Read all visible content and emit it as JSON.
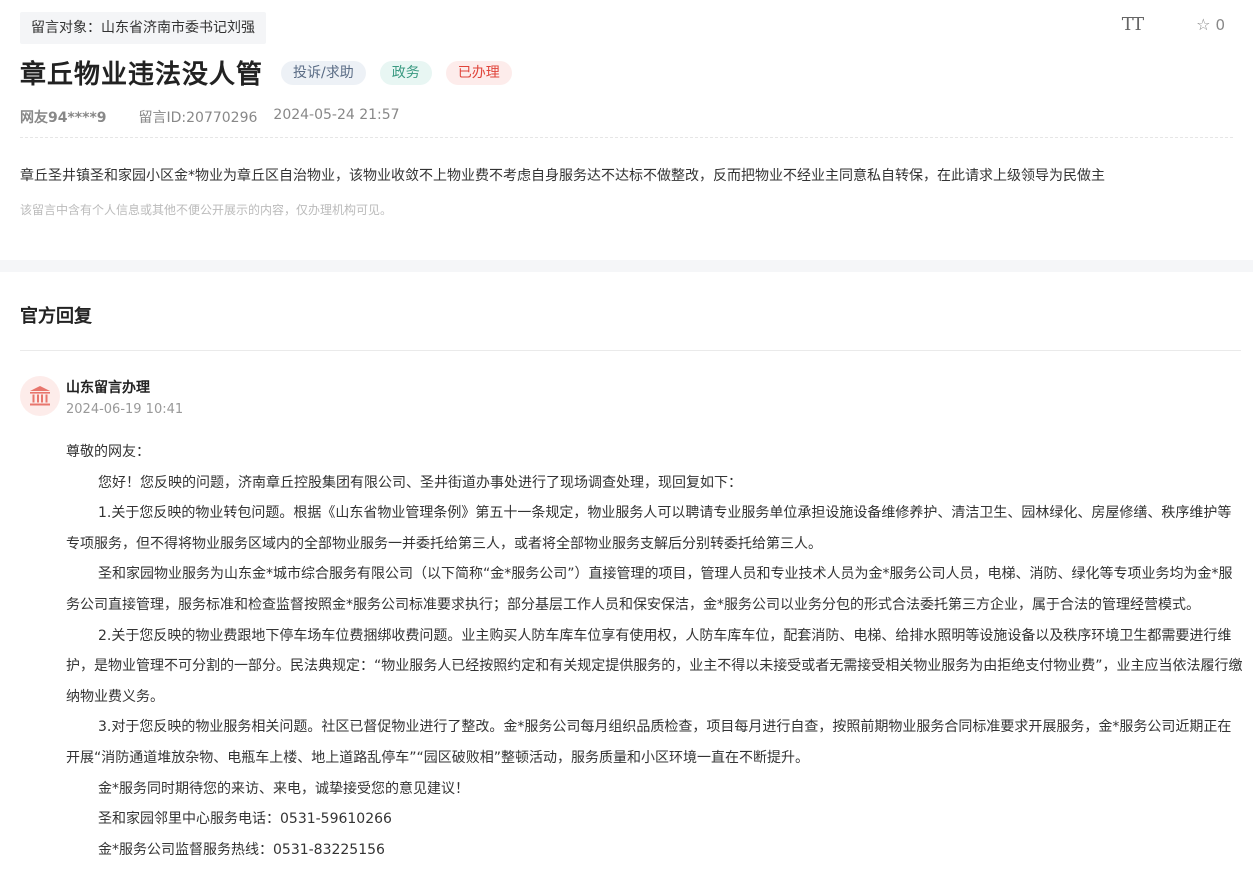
{
  "header": {
    "recipient": "留言对象：山东省济南市委书记刘强",
    "font_size_icon": "TT",
    "favorite_count": "0"
  },
  "message": {
    "title": "章丘物业违法没人管",
    "tags": {
      "type": "投诉/求助",
      "department": "政务",
      "status": "已办理"
    },
    "user": "网友94****9",
    "message_id": "留言ID:20770296",
    "date": "2024-05-24 21:57",
    "content": "章丘圣井镇圣和家园小区金*物业为章丘区自治物业，该物业收敛不上物业费不考虑自身服务达不达标不做整改，反而把物业不经业主同意私自转保，在此请求上级领导为民做主",
    "privacy_note": "该留言中含有个人信息或其他不便公开展示的内容，仅办理机构可见。"
  },
  "reply": {
    "heading": "官方回复",
    "replier": "山东留言办理",
    "time": "2024-06-19 10:41",
    "greeting": "尊敬的网友：",
    "paragraphs": [
      "您好！您反映的问题，济南章丘控股集团有限公司、圣井街道办事处进行了现场调查处理，现回复如下：",
      "1.关于您反映的物业转包问题。根据《山东省物业管理条例》第五十一条规定，物业服务人可以聘请专业服务单位承担设施设备维修养护、清洁卫生、园林绿化、房屋修缮、秩序维护等专项服务，但不得将物业服务区域内的全部物业服务一并委托给第三人，或者将全部物业服务支解后分别转委托给第三人。",
      "圣和家园物业服务为山东金*城市综合服务有限公司（以下简称“金*服务公司”）直接管理的项目，管理人员和专业技术人员为金*服务公司人员，电梯、消防、绿化等专项业务均为金*服务公司直接管理，服务标准和检查监督按照金*服务公司标准要求执行；部分基层工作人员和保安保洁，金*服务公司以业务分包的形式合法委托第三方企业，属于合法的管理经营模式。",
      "2.关于您反映的物业费跟地下停车场车位费捆绑收费问题。业主购买人防车库车位享有使用权，人防车库车位，配套消防、电梯、给排水照明等设施设备以及秩序环境卫生都需要进行维护，是物业管理不可分割的一部分。民法典规定：“物业服务人已经按照约定和有关规定提供服务的，业主不得以未接受或者无需接受相关物业服务为由拒绝支付物业费”，业主应当依法履行缴纳物业费义务。",
      "3.对于您反映的物业服务相关问题。社区已督促物业进行了整改。金*服务公司每月组织品质检查，项目每月进行自查，按照前期物业服务合同标准要求开展服务，金*服务公司近期正在开展“消防通道堆放杂物、电瓶车上楼、地上道路乱停车”“园区破败相”整顿活动，服务质量和小区环境一直在不断提升。",
      "金*服务同时期待您的来访、来电，诚挚接受您的意见建议！",
      "圣和家园邻里中心服务电话：0531-59610266",
      "金*服务公司监督服务热线：0531-83225156"
    ]
  }
}
